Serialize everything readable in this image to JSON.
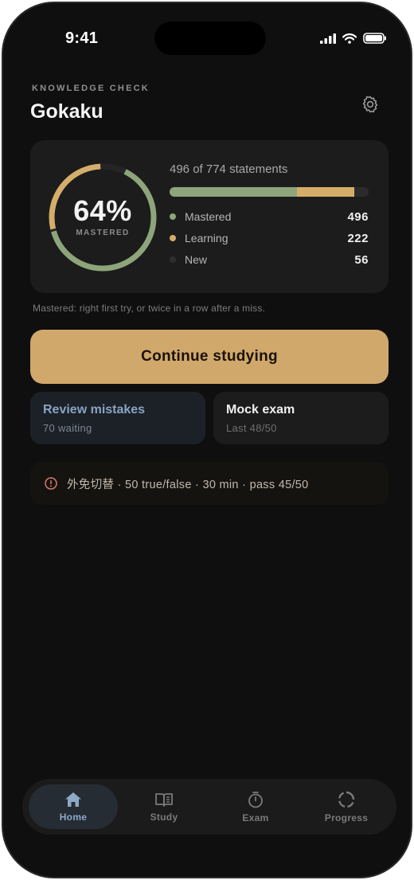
{
  "status_bar": {
    "time": "9:41"
  },
  "header": {
    "eyebrow": "KNOWLEDGE CHECK",
    "title": "Gokaku"
  },
  "summary": {
    "percent_label": "64%",
    "ring_caption": "MASTERED",
    "statements_text": "496 of 774 statements",
    "total": 774,
    "legend": [
      {
        "label": "Mastered",
        "value": "496",
        "count": 496,
        "color": "#8da57a"
      },
      {
        "label": "Learning",
        "value": "222",
        "count": 222,
        "color": "#d5ad6b"
      },
      {
        "label": "New",
        "value": "56",
        "count": 56,
        "color": "#2e2e2e"
      }
    ]
  },
  "footnote": "Mastered: right first try, or twice in a row after a miss.",
  "cta": {
    "label": "Continue studying"
  },
  "tiles": {
    "review": {
      "title": "Review mistakes",
      "subtitle": "70 waiting"
    },
    "mock": {
      "title": "Mock exam",
      "subtitle": "Last 48/50"
    }
  },
  "info": {
    "jp": "外免切替",
    "rest": " · 50 true/false · 30 min · pass 45/50"
  },
  "tabs": [
    {
      "label": "Home",
      "icon": "home-icon",
      "active": true
    },
    {
      "label": "Study",
      "icon": "book-icon",
      "active": false
    },
    {
      "label": "Exam",
      "icon": "stopwatch-icon",
      "active": false
    },
    {
      "label": "Progress",
      "icon": "progress-ring-icon",
      "active": false
    }
  ],
  "colors": {
    "accent": "#d1a86b",
    "mastered": "#8da57a",
    "learning": "#d5ad6b",
    "tab_active": "#8fa8c8"
  }
}
